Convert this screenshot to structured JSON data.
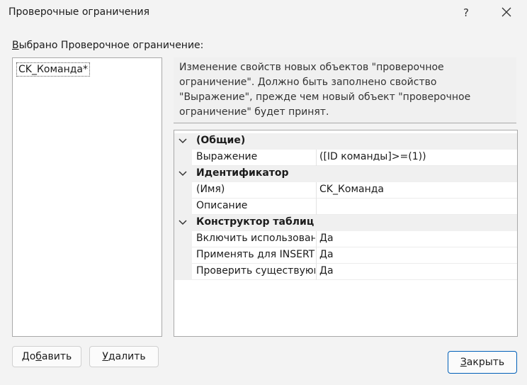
{
  "window": {
    "title": "Проверочные ограничения",
    "help_glyph": "?"
  },
  "selected_label": {
    "mnemonic": "В",
    "rest": "ыбрано Проверочное ограничение:"
  },
  "constraints": [
    {
      "name": "CK_Команда*"
    }
  ],
  "description": "Изменение свойств новых объектов \"проверочное ограничение\". Должно быть заполнено свойство \"Выражение\", прежде чем новый объект \"проверочное ограничение\" будет принят.",
  "properties": {
    "general": {
      "category": "(Общие)",
      "expression_label": "Выражение",
      "expression_value": "([ID команды]>=(1))"
    },
    "identity": {
      "category": "Идентификатор",
      "name_label": "(Имя)",
      "name_value": "CK_Команда",
      "description_label": "Описание",
      "description_value": ""
    },
    "designer": {
      "category": "Конструктор таблиц",
      "enforce_label": "Включить использование для репликации",
      "enforce_value": "Да",
      "insert_update_label": "Применять для INSERT и UPDATE",
      "insert_update_value": "Да",
      "check_existing_label": "Проверить существующие данные при создании или включении",
      "check_existing_value": "Да"
    }
  },
  "buttons": {
    "add": {
      "before": "До",
      "mnemonic": "б",
      "after": "авить"
    },
    "remove": {
      "mnemonic": "У",
      "after": "далить"
    },
    "close": {
      "mnemonic": "З",
      "after": "акрыть"
    }
  }
}
